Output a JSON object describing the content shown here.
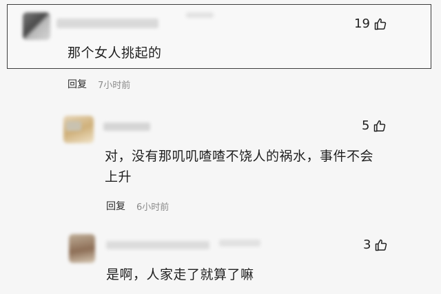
{
  "comments": [
    {
      "text": "那个女人挑起的",
      "likes": "19",
      "reply": "回复",
      "time": "7小时前"
    },
    {
      "text_line1": "对，没有那叽叽喳喳不饶人的祸水，事件不会",
      "text_line2": "上升",
      "likes": "5",
      "reply": "回复",
      "time": "6小时前"
    },
    {
      "text": "是啊，人家走了就算了嘛",
      "likes": "3"
    }
  ],
  "icons": {
    "like": "thumbs-up-icon"
  }
}
